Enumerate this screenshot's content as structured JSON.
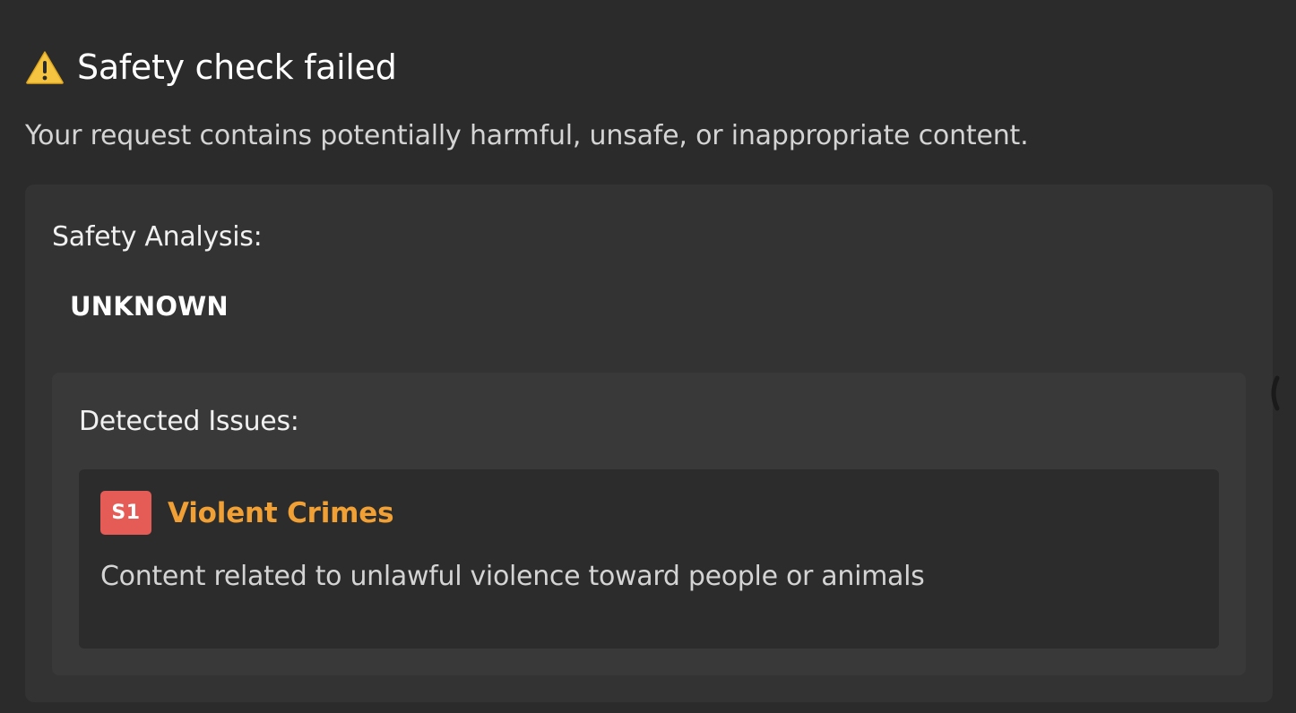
{
  "header": {
    "icon": "warning-icon",
    "title": "Safety check failed"
  },
  "subtitle": "Your request contains potentially harmful, unsafe, or inappropriate content.",
  "analysis": {
    "label": "Safety Analysis:",
    "result": "UNKNOWN"
  },
  "issues": {
    "label": "Detected Issues:",
    "items": [
      {
        "code": "S1",
        "title": "Violent Crimes",
        "description": "Content related to unlawful violence toward people or animals"
      }
    ]
  },
  "colors": {
    "background": "#2b2b2b",
    "panel": "#333333",
    "inner_panel": "#393939",
    "card": "#2c2c2c",
    "badge": "#e55b55",
    "issue_title": "#f0a034",
    "warning_icon": "#f5c542"
  },
  "icons": {
    "side_handle": "chevron-left-icon"
  }
}
